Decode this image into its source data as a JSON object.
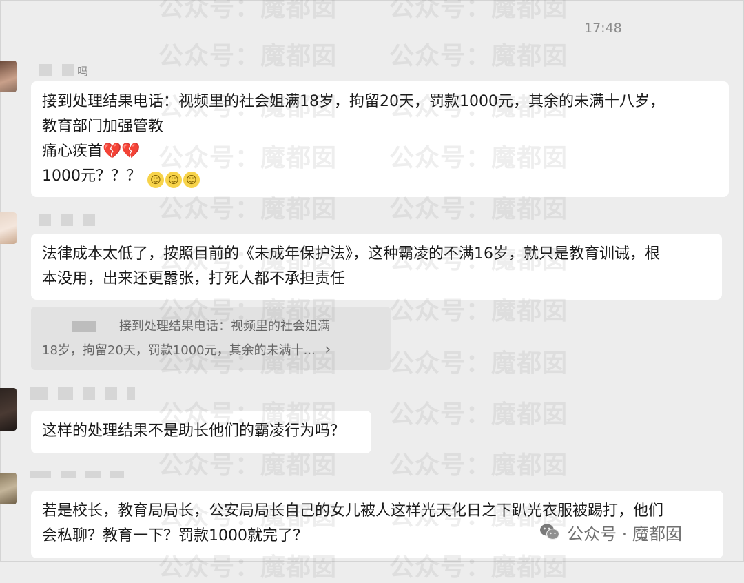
{
  "time": "17:48",
  "watermark_text": "公众号：魔都囡",
  "messages": [
    {
      "nickname_suffix": "吗",
      "lines": [
        "接到处理结果电话：视频里的社会姐满18岁，拘留20天，罚款1000元，其余的未满十八岁，",
        "教育部门加强管教",
        "痛心疾首",
        "1000元？？？"
      ]
    },
    {
      "lines": [
        "法律成本太低了，按照目前的《未成年保护法》，这种霸凌的不满16岁，就只是教育训诫，根",
        "本没用，出来还更嚣张，打死人都不承担责任"
      ],
      "quote": {
        "line1": "接到处理结果电话：视频里的社会姐满",
        "line2": "18岁，拘留20天，罚款1000元，其余的未满十...",
        "arrow": "›"
      }
    },
    {
      "lines": [
        "这样的处理结果不是助长他们的霸凌行为吗？"
      ]
    },
    {
      "lines": [
        "若是校长，教育局局长，公安局局长自己的女儿被人这样光天化日之下趴光衣服被踢打，他们",
        "会私聊？教育一下？罚款1000就完了？"
      ]
    }
  ],
  "footer": {
    "logo_text": "公众号 · 魔都囡"
  },
  "icons": {
    "broken_heart": "💔",
    "emoji_face": "☺"
  }
}
